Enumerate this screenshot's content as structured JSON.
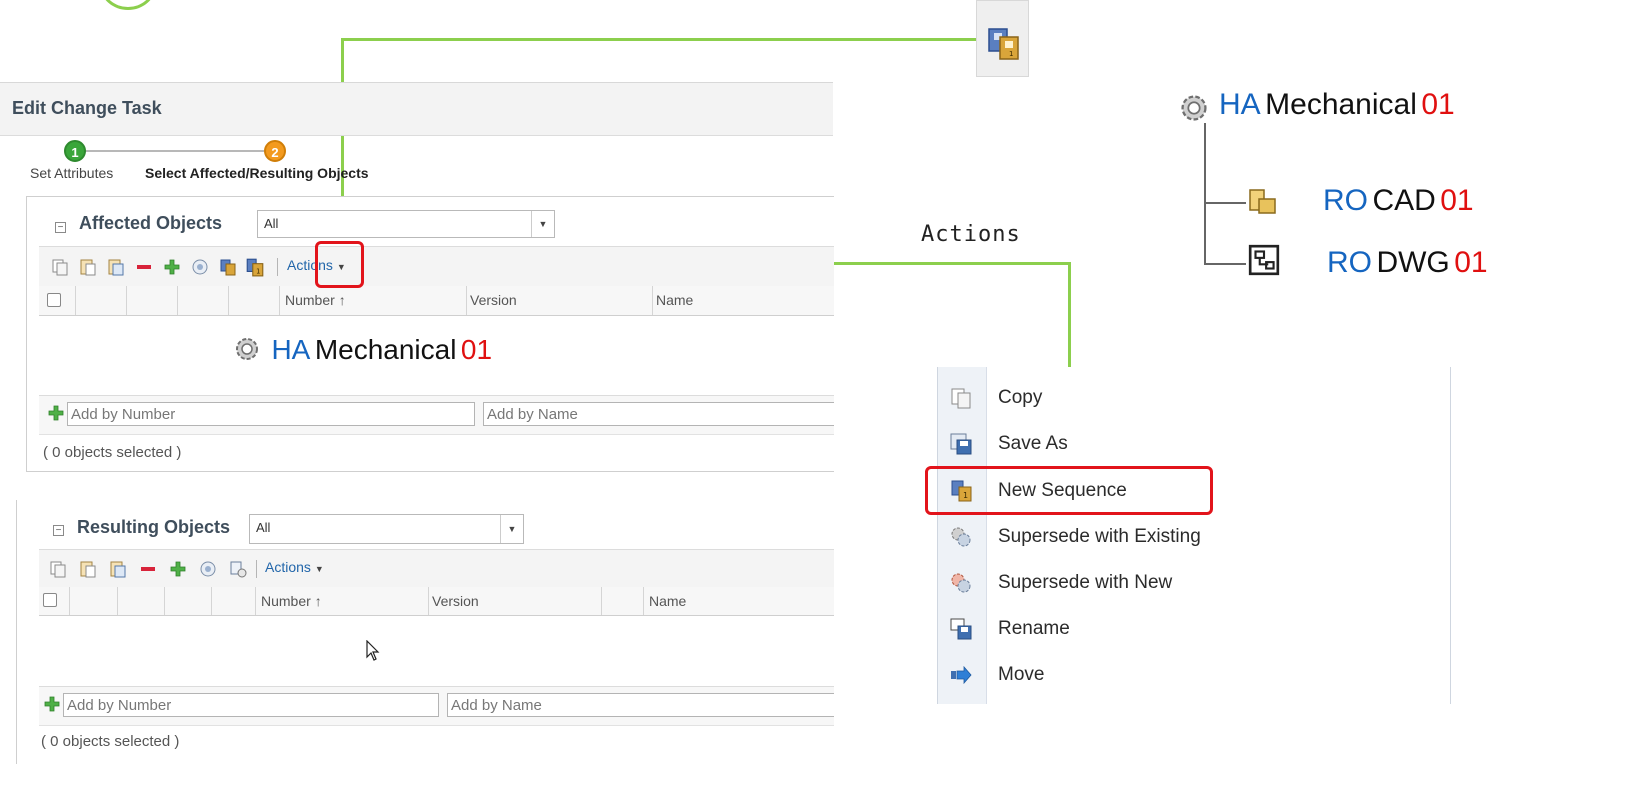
{
  "dialog": {
    "title": "Edit Change Task"
  },
  "wizard": {
    "steps": [
      {
        "number": "1",
        "label": "Set Attributes",
        "color": "#3aa63a"
      },
      {
        "number": "2",
        "label": "Select Affected/Resulting Objects",
        "color": "#f39a1e"
      }
    ]
  },
  "affected": {
    "title": "Affected Objects",
    "filter_value": "All",
    "actions_label": "Actions",
    "columns": [
      "Number",
      "Version",
      "Name"
    ],
    "sort_glyph": "↑",
    "row_item": {
      "prefix": "HA",
      "name": "Mechanical",
      "rev": "01"
    },
    "add_by_number_placeholder": "Add by Number",
    "add_by_name_placeholder": "Add by Name",
    "selection_status": "( 0 objects selected )"
  },
  "resulting": {
    "title": "Resulting Objects",
    "filter_value": "All",
    "actions_label": "Actions",
    "columns": [
      "Number",
      "Version",
      "Name"
    ],
    "sort_glyph": "↑",
    "add_by_number_placeholder": "Add by Number",
    "add_by_name_placeholder": "Add by Name",
    "selection_status": "( 0 objects selected )"
  },
  "callout": {
    "actions_label": "Actions"
  },
  "structure": {
    "root": {
      "prefix": "HA",
      "name": "Mechanical",
      "rev": "01",
      "icon": "gear-icon"
    },
    "children": [
      {
        "prefix": "RO",
        "name": "CAD",
        "rev": "01",
        "icon": "part-icon"
      },
      {
        "prefix": "RO",
        "name": "DWG",
        "rev": "01",
        "icon": "drawing-icon"
      }
    ]
  },
  "actions_menu": {
    "items": [
      {
        "label": "Copy",
        "icon": "copy-icon"
      },
      {
        "label": "Save As",
        "icon": "save-as-icon"
      },
      {
        "label": "New Sequence",
        "icon": "new-sequence-icon",
        "highlighted": true
      },
      {
        "label": "Supersede with Existing",
        "icon": "supersede-existing-icon"
      },
      {
        "label": "Supersede with New",
        "icon": "supersede-new-icon"
      },
      {
        "label": "Rename",
        "icon": "rename-icon"
      },
      {
        "label": "Move",
        "icon": "move-icon"
      }
    ]
  },
  "colors": {
    "accent_line": "#8ccf4d",
    "highlight": "#e2141b",
    "prefix_blue": "#1565c0",
    "rev_red": "#e01010"
  }
}
